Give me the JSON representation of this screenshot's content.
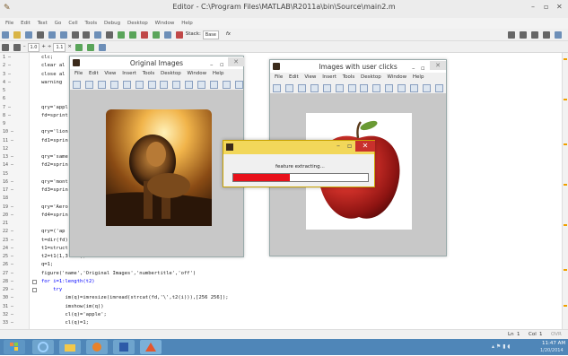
{
  "window": {
    "title": "Editor - C:\\Program Files\\MATLAB\\R2011a\\bin\\Source\\main2.m",
    "minimize": "–",
    "maximize": "▫",
    "close": "✕"
  },
  "menu": [
    "File",
    "Edit",
    "Text",
    "Go",
    "Cell",
    "Tools",
    "Debug",
    "Desktop",
    "Window",
    "Help"
  ],
  "toolbar": {
    "stack_label": "Stack:",
    "stack_value": "Base",
    "fx_label": "fx",
    "cell_minus": "–",
    "cell_value1": "1.0",
    "cell_plus": "+",
    "cell_div": "÷",
    "cell_value2": "1.1",
    "cell_times": "×"
  },
  "editor": {
    "line_numbers": [
      "1 –",
      "2 –",
      "3 –",
      "4 –",
      "5",
      "6",
      "7 –",
      "8 –",
      "9",
      "10 –",
      "11 –",
      "12",
      "13 –",
      "14 –",
      "15",
      "16 –",
      "17 –",
      "18",
      "19 –",
      "20 –",
      "21",
      "22 –",
      "23 –",
      "24 –",
      "25 –",
      "26 –",
      "27 –",
      "28 –",
      "29 –",
      "30 –",
      "31 –",
      "32 –",
      "33 –"
    ],
    "lines": [
      {
        "n": 0,
        "text": "clc;",
        "cls": ""
      },
      {
        "n": 1,
        "text": "clear al",
        "cls": ""
      },
      {
        "n": 2,
        "text": "close al",
        "cls": ""
      },
      {
        "n": 3,
        "text": "warning",
        "cls": ""
      },
      {
        "n": 6,
        "text": "qry='appl",
        "cls": ""
      },
      {
        "n": 7,
        "text": "fd=sprint",
        "cls": ""
      },
      {
        "n": 9,
        "text": "qry='lion",
        "cls": ""
      },
      {
        "n": 10,
        "text": "fd1=sprin",
        "cls": ""
      },
      {
        "n": 12,
        "text": "qry='same",
        "cls": ""
      },
      {
        "n": 13,
        "text": "fd2=sprin",
        "cls": ""
      },
      {
        "n": 15,
        "text": "qry='mont",
        "cls": ""
      },
      {
        "n": 16,
        "text": "fd3=sprin",
        "cls": ""
      },
      {
        "n": 18,
        "text": "qry='Aero",
        "cls": ""
      },
      {
        "n": 19,
        "text": "fd4=sprin",
        "cls": ""
      },
      {
        "n": 21,
        "text": "qry=('ap",
        "cls": ""
      },
      {
        "n": 22,
        "text": "t=dir(fd)",
        "cls": ""
      },
      {
        "n": 23,
        "text": "t1=struct",
        "cls": ""
      },
      {
        "n": 24,
        "text": "t2=t1(1,3:end);",
        "cls": ""
      },
      {
        "n": 25,
        "text": "q=1;",
        "cls": ""
      },
      {
        "n": 26,
        "text": "figure('name','Original Images','numbertitle','off')",
        "cls": ""
      },
      {
        "n": 27,
        "text": "for i=1:length(t2)",
        "cls": "kw"
      },
      {
        "n": 28,
        "text": "    try",
        "cls": "kw"
      },
      {
        "n": 29,
        "text": "        im(q)=imresize(imread(strcat(fd,'\\',t2(i))),[256 256]);",
        "cls": ""
      },
      {
        "n": 30,
        "text": "        imshow(im(q))",
        "cls": ""
      },
      {
        "n": 31,
        "text": "        cl(q)='apple';",
        "cls": ""
      },
      {
        "n": 32,
        "text": "        cl(q)=1;",
        "cls": ""
      }
    ]
  },
  "fig1": {
    "title": "Original Images",
    "menu": [
      "File",
      "Edit",
      "View",
      "Insert",
      "Tools",
      "Desktop",
      "Window",
      "Help"
    ]
  },
  "fig2": {
    "title": "Images with user clicks",
    "menu": [
      "File",
      "Edit",
      "View",
      "Insert",
      "Tools",
      "Desktop",
      "Window",
      "Help"
    ]
  },
  "progress": {
    "label": "feature extracting...",
    "fraction": 0.42,
    "bar_color": "#e8101a"
  },
  "status": {
    "ln_label": "Ln",
    "ln_value": "1",
    "col_label": "Col",
    "col_value": "1",
    "mode": "OVR"
  },
  "taskbar": {
    "time": "11:47 AM",
    "date": "1/20/2014"
  },
  "colors": {
    "taskbar": "#4f86b8",
    "progress_title": "#f2d75a",
    "progress_close": "#c9302c"
  }
}
